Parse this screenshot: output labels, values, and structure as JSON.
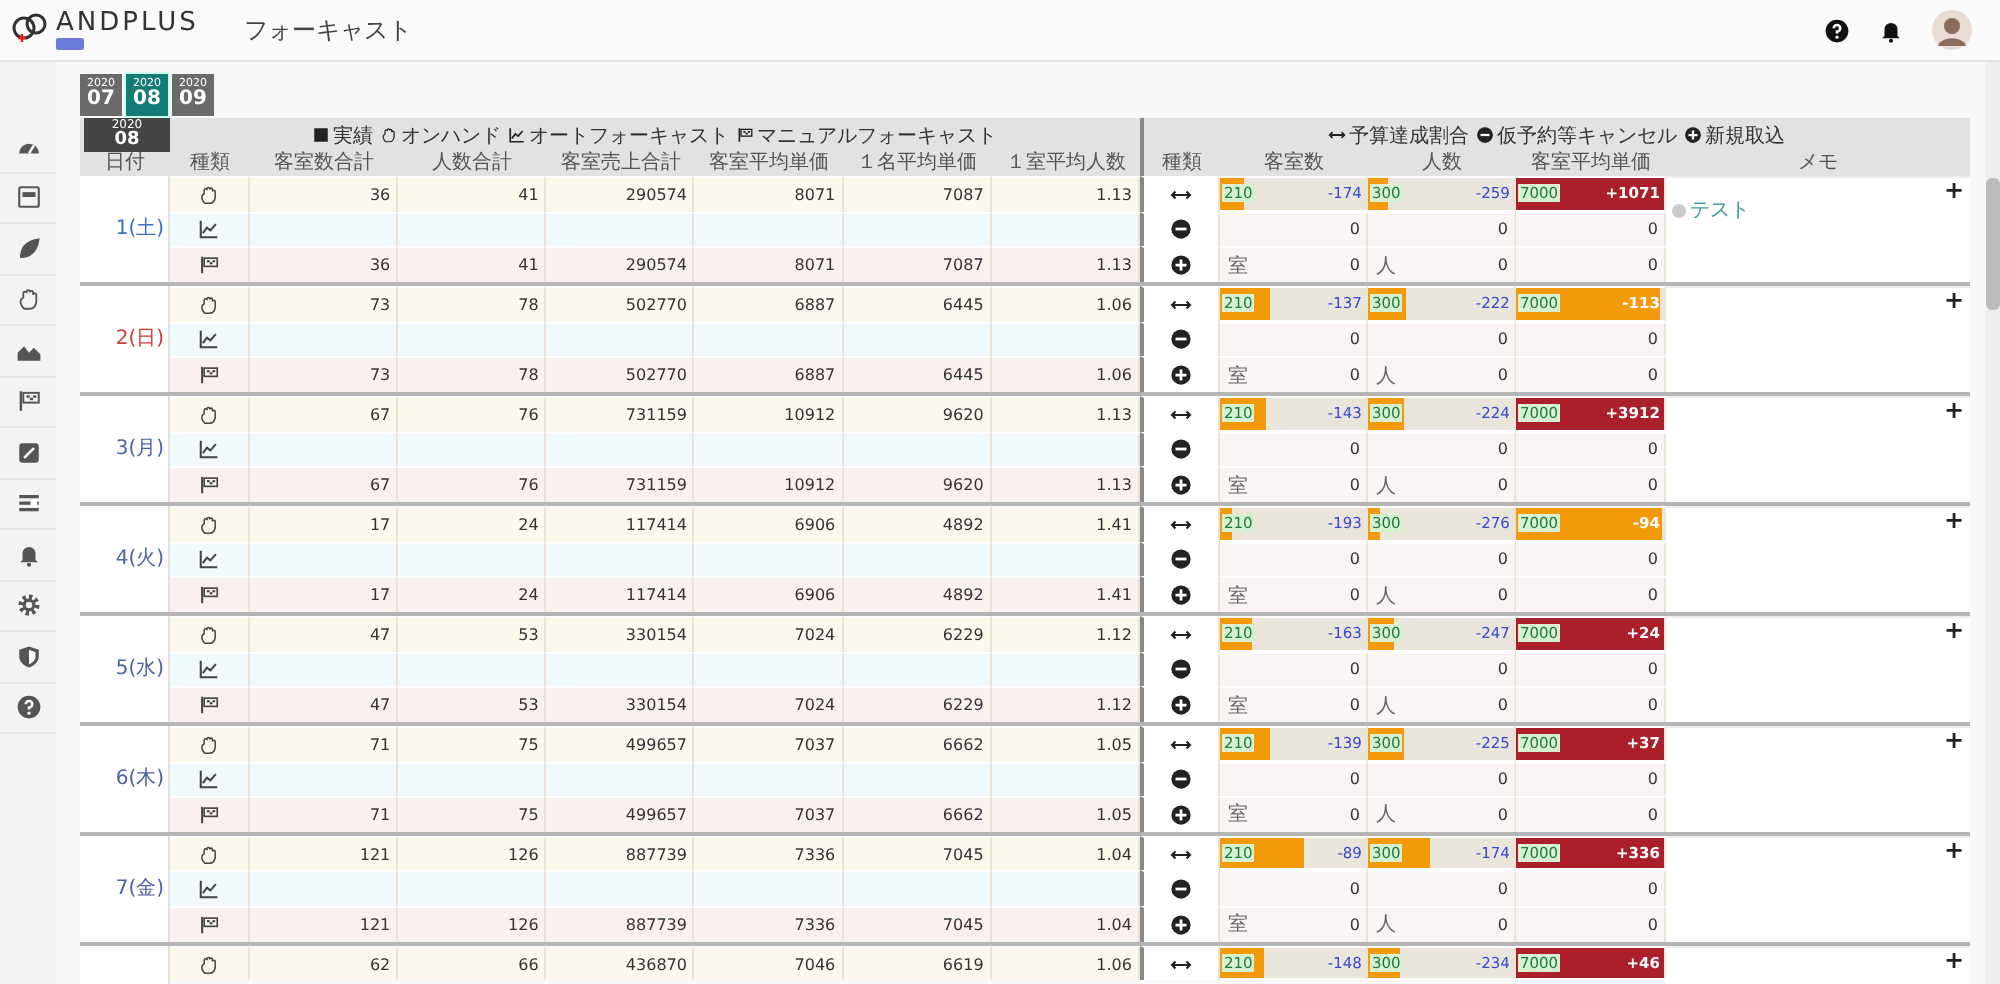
{
  "header": {
    "logo": "ANDPLUS",
    "title": "フォーキャスト"
  },
  "months": [
    {
      "year": "2020",
      "month": "07",
      "selected": false
    },
    {
      "year": "2020",
      "month": "08",
      "selected": true
    },
    {
      "year": "2020",
      "month": "09",
      "selected": false
    }
  ],
  "table": {
    "current": {
      "year": "2020",
      "month": "08"
    },
    "legend": [
      {
        "kind": "record",
        "label": "実績"
      },
      {
        "kind": "onhand",
        "label": "オンハンド"
      },
      {
        "kind": "auto",
        "label": "オートフォーキャスト"
      },
      {
        "kind": "manual",
        "label": "マニュアルフォーキャスト"
      }
    ],
    "side_legend": [
      {
        "kind": "budget",
        "label": "予算達成割合"
      },
      {
        "kind": "cancel",
        "label": "仮予約等キャンセル"
      },
      {
        "kind": "new",
        "label": "新規取込"
      }
    ],
    "columns": [
      "日付",
      "種類",
      "客室数合計",
      "人数合計",
      "客室売上合計",
      "客室平均単価",
      "１名平均単価",
      "１室平均人数"
    ],
    "side_columns": [
      "種類",
      "客室数",
      "人数",
      "客室平均単価",
      "メモ"
    ],
    "days": [
      {
        "date": "1(土)",
        "kind": "saturday",
        "add_button": "+",
        "memo": "テスト",
        "rows": [
          {
            "kind": "onhand",
            "values": [
              "36",
              "41",
              "290574",
              "8071",
              "7087",
              "1.13"
            ]
          },
          {
            "kind": "auto"
          },
          {
            "kind": "manual",
            "values": [
              "36",
              "41",
              "290574",
              "8071",
              "7087",
              "1.13"
            ]
          }
        ],
        "side_rows": [
          {
            "kind": "budget",
            "bars": [
              {
                "target": "210",
                "level": 0.17,
                "reading": "-174"
              },
              {
                "target": "300",
                "level": 0.14,
                "reading": "-259"
              },
              {
                "target": "7000",
                "level": 1,
                "reading": "+1071"
              }
            ]
          },
          {
            "kind": "cancel",
            "cells": [
              {
                "value": "0"
              },
              {
                "value": "0"
              },
              {
                "value": "0"
              }
            ]
          },
          {
            "kind": "new",
            "cells": [
              {
                "unit": "室",
                "value": "0"
              },
              {
                "unit": "人",
                "value": "0"
              },
              {
                "value": "0"
              }
            ]
          }
        ]
      },
      {
        "date": "2(日)",
        "kind": "sunday",
        "add_button": "+",
        "rows": [
          {
            "kind": "onhand",
            "values": [
              "73",
              "78",
              "502770",
              "6887",
              "6445",
              "1.06"
            ]
          },
          {
            "kind": "auto"
          },
          {
            "kind": "manual",
            "values": [
              "73",
              "78",
              "502770",
              "6887",
              "6445",
              "1.06"
            ]
          }
        ],
        "side_rows": [
          {
            "kind": "budget",
            "bars": [
              {
                "target": "210",
                "level": 0.35,
                "reading": "-137"
              },
              {
                "target": "300",
                "level": 0.26,
                "reading": "-222"
              },
              {
                "target": "7000",
                "level": 0.98,
                "reading": "-113"
              }
            ]
          },
          {
            "kind": "cancel",
            "cells": [
              {
                "value": "0"
              },
              {
                "value": "0"
              },
              {
                "value": "0"
              }
            ]
          },
          {
            "kind": "new",
            "cells": [
              {
                "unit": "室",
                "value": "0"
              },
              {
                "unit": "人",
                "value": "0"
              },
              {
                "value": "0"
              }
            ]
          }
        ]
      },
      {
        "date": "3(月)",
        "kind": "weekday",
        "add_button": "+",
        "rows": [
          {
            "kind": "onhand",
            "values": [
              "67",
              "76",
              "731159",
              "10912",
              "9620",
              "1.13"
            ]
          },
          {
            "kind": "auto"
          },
          {
            "kind": "manual",
            "values": [
              "67",
              "76",
              "731159",
              "10912",
              "9620",
              "1.13"
            ]
          }
        ],
        "side_rows": [
          {
            "kind": "budget",
            "bars": [
              {
                "target": "210",
                "level": 0.32,
                "reading": "-143"
              },
              {
                "target": "300",
                "level": 0.25,
                "reading": "-224"
              },
              {
                "target": "7000",
                "level": 1,
                "reading": "+3912"
              }
            ]
          },
          {
            "kind": "cancel",
            "cells": [
              {
                "value": "0"
              },
              {
                "value": "0"
              },
              {
                "value": "0"
              }
            ]
          },
          {
            "kind": "new",
            "cells": [
              {
                "unit": "室",
                "value": "0"
              },
              {
                "unit": "人",
                "value": "0"
              },
              {
                "value": "0"
              }
            ]
          }
        ]
      },
      {
        "date": "4(火)",
        "kind": "weekday",
        "add_button": "+",
        "rows": [
          {
            "kind": "onhand",
            "values": [
              "17",
              "24",
              "117414",
              "6906",
              "4892",
              "1.41"
            ]
          },
          {
            "kind": "auto"
          },
          {
            "kind": "manual",
            "values": [
              "17",
              "24",
              "117414",
              "6906",
              "4892",
              "1.41"
            ]
          }
        ],
        "side_rows": [
          {
            "kind": "budget",
            "bars": [
              {
                "target": "210",
                "level": 0.08,
                "reading": "-193"
              },
              {
                "target": "300",
                "level": 0.08,
                "reading": "-276"
              },
              {
                "target": "7000",
                "level": 0.99,
                "reading": "-94"
              }
            ]
          },
          {
            "kind": "cancel",
            "cells": [
              {
                "value": "0"
              },
              {
                "value": "0"
              },
              {
                "value": "0"
              }
            ]
          },
          {
            "kind": "new",
            "cells": [
              {
                "unit": "室",
                "value": "0"
              },
              {
                "unit": "人",
                "value": "0"
              },
              {
                "value": "0"
              }
            ]
          }
        ]
      },
      {
        "date": "5(水)",
        "kind": "weekday",
        "add_button": "+",
        "rows": [
          {
            "kind": "onhand",
            "values": [
              "47",
              "53",
              "330154",
              "7024",
              "6229",
              "1.12"
            ]
          },
          {
            "kind": "auto"
          },
          {
            "kind": "manual",
            "values": [
              "47",
              "53",
              "330154",
              "7024",
              "6229",
              "1.12"
            ]
          }
        ],
        "side_rows": [
          {
            "kind": "budget",
            "bars": [
              {
                "target": "210",
                "level": 0.22,
                "reading": "-163"
              },
              {
                "target": "300",
                "level": 0.18,
                "reading": "-247"
              },
              {
                "target": "7000",
                "level": 1,
                "reading": "+24"
              }
            ]
          },
          {
            "kind": "cancel",
            "cells": [
              {
                "value": "0"
              },
              {
                "value": "0"
              },
              {
                "value": "0"
              }
            ]
          },
          {
            "kind": "new",
            "cells": [
              {
                "unit": "室",
                "value": "0"
              },
              {
                "unit": "人",
                "value": "0"
              },
              {
                "value": "0"
              }
            ]
          }
        ]
      },
      {
        "date": "6(木)",
        "kind": "weekday",
        "add_button": "+",
        "rows": [
          {
            "kind": "onhand",
            "values": [
              "71",
              "75",
              "499657",
              "7037",
              "6662",
              "1.05"
            ]
          },
          {
            "kind": "auto"
          },
          {
            "kind": "manual",
            "values": [
              "71",
              "75",
              "499657",
              "7037",
              "6662",
              "1.05"
            ]
          }
        ],
        "side_rows": [
          {
            "kind": "budget",
            "bars": [
              {
                "target": "210",
                "level": 0.34,
                "reading": "-139"
              },
              {
                "target": "300",
                "level": 0.25,
                "reading": "-225"
              },
              {
                "target": "7000",
                "level": 1,
                "reading": "+37"
              }
            ]
          },
          {
            "kind": "cancel",
            "cells": [
              {
                "value": "0"
              },
              {
                "value": "0"
              },
              {
                "value": "0"
              }
            ]
          },
          {
            "kind": "new",
            "cells": [
              {
                "unit": "室",
                "value": "0"
              },
              {
                "unit": "人",
                "value": "0"
              },
              {
                "value": "0"
              }
            ]
          }
        ]
      },
      {
        "date": "7(金)",
        "kind": "weekday",
        "add_button": "+",
        "rows": [
          {
            "kind": "onhand",
            "values": [
              "121",
              "126",
              "887739",
              "7336",
              "7045",
              "1.04"
            ]
          },
          {
            "kind": "auto"
          },
          {
            "kind": "manual",
            "values": [
              "121",
              "126",
              "887739",
              "7336",
              "7045",
              "1.04"
            ]
          }
        ],
        "side_rows": [
          {
            "kind": "budget",
            "bars": [
              {
                "target": "210",
                "level": 0.58,
                "reading": "-89"
              },
              {
                "target": "300",
                "level": 0.42,
                "reading": "-174"
              },
              {
                "target": "7000",
                "level": 1,
                "reading": "+336"
              }
            ]
          },
          {
            "kind": "cancel",
            "cells": [
              {
                "value": "0"
              },
              {
                "value": "0"
              },
              {
                "value": "0"
              }
            ]
          },
          {
            "kind": "new",
            "cells": [
              {
                "unit": "室",
                "value": "0"
              },
              {
                "unit": "人",
                "value": "0"
              },
              {
                "value": "0"
              }
            ]
          }
        ]
      },
      {
        "add_button": "+",
        "rows": [
          {
            "kind": "onhand",
            "values": [
              "62",
              "66",
              "436870",
              "7046",
              "6619",
              "1.06"
            ]
          }
        ],
        "side_rows": [
          {
            "kind": "budget",
            "bars": [
              {
                "target": "210",
                "level": 0.3,
                "reading": "-148"
              },
              {
                "target": "300",
                "level": 0.22,
                "reading": "-234"
              },
              {
                "target": "7000",
                "level": 1,
                "reading": "+46"
              }
            ]
          }
        ]
      }
    ]
  }
}
